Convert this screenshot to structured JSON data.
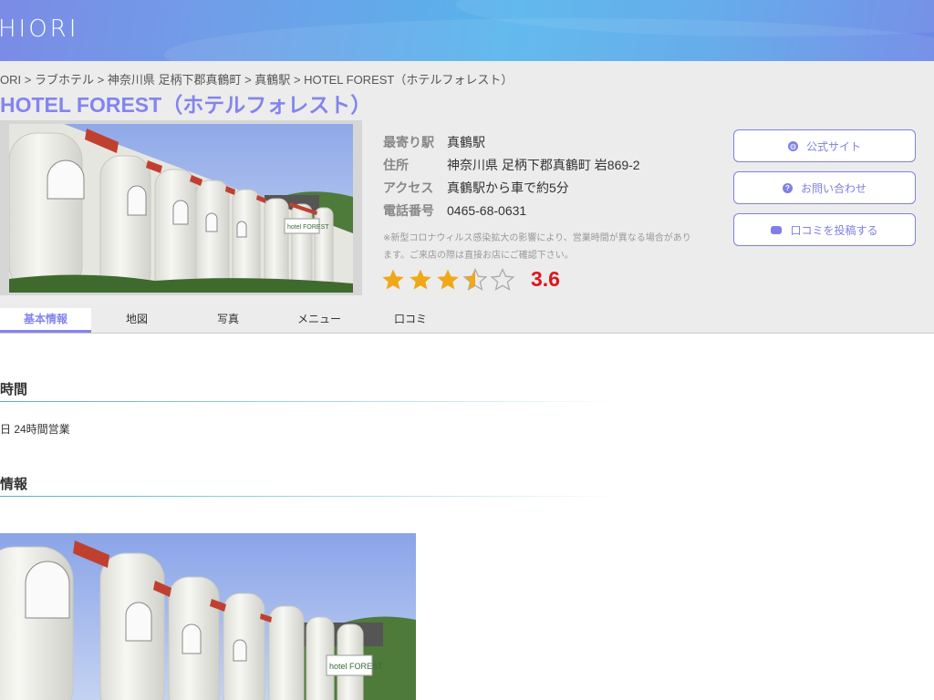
{
  "header": {
    "logo_text": "HIORI"
  },
  "breadcrumb": [
    "ORI",
    "ラブホテル",
    "神奈川県 足柄下郡真鶴町",
    "真鶴駅",
    "HOTEL FOREST（ホテルフォレスト）"
  ],
  "breadcrumb_sep": ">",
  "hotel": {
    "title": "HOTEL FOREST（ホテルフォレスト）",
    "photo_sign": "hotel FOREST",
    "info": [
      {
        "label": "最寄り駅",
        "value": "真鶴駅"
      },
      {
        "label": "住所",
        "value": "神奈川県 足柄下郡真鶴町 岩869-2"
      },
      {
        "label": "アクセス",
        "value": "真鶴駅から車で約5分"
      },
      {
        "label": "電話番号",
        "value": "0465-68-0631"
      }
    ],
    "note": "※新型コロナウィルス感染拡大の影響により、営業時間が異なる場合があります。ご来店の際は直接お店にご確認下さい。",
    "rating": 3.6,
    "rating_text": "3.6",
    "star_color": "#f0a818"
  },
  "buttons": [
    {
      "label": "公式サイト",
      "icon": "globe-icon"
    },
    {
      "label": "お問い合わせ",
      "icon": "question-icon"
    },
    {
      "label": "口コミを投稿する",
      "icon": "comments-icon"
    }
  ],
  "tabs": [
    {
      "label": "基本情報",
      "active": true
    },
    {
      "label": "地図",
      "active": false
    },
    {
      "label": "写真",
      "active": false
    },
    {
      "label": "メニュー",
      "active": false
    },
    {
      "label": "口コミ",
      "active": false
    }
  ],
  "sections": {
    "hours_title": "時間",
    "hours_text": "日 24時間営業",
    "info_title": "情報"
  },
  "colors": {
    "accent": "#8484ee",
    "rating": "#e0141e"
  }
}
